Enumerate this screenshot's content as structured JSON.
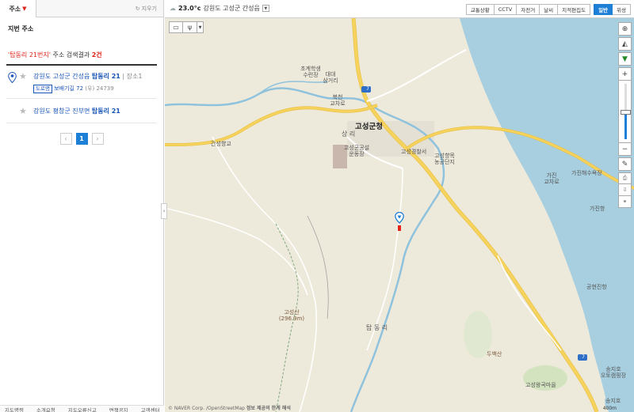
{
  "left_panel": {
    "tab_label": "주소",
    "clear_label": "지우기",
    "section_title": "지번 주소",
    "summary": {
      "query": "'탑동리 21번지'",
      "text": " 주소 검색결과 ",
      "count": "2건"
    },
    "results": [
      {
        "prefix": "강원도 고성군 간성읍 ",
        "highlight": "탑동리 21",
        "sep": " | ",
        "meta": "장소",
        "meta_count": "1",
        "road_badge": "도로명",
        "road_addr": "보배기길 72",
        "zip": " (우) 24739"
      },
      {
        "prefix": "강원도 평창군 진부면 ",
        "highlight": "탑동리 21"
      }
    ],
    "pagination": {
      "prev": "‹",
      "current": "1",
      "next": "›"
    },
    "footer": [
      "지도명령",
      "소개요청",
      "지도오류신고",
      "면책공지",
      "고객센터"
    ]
  },
  "top_bar": {
    "weather_temp": "23.0°c",
    "weather_loc": "강원도 고성군 간성읍",
    "layers": [
      "교통상황",
      "CCTV",
      "자전거",
      "날씨",
      "지적편집도"
    ],
    "map_types": [
      "일반",
      "위성"
    ],
    "active_map_type": "일반"
  },
  "map_labels": {
    "county_office": "고성군청",
    "sangri": "상 리",
    "police": "고성경찰서",
    "stadium": "고성군공설\n운동장",
    "industrial": "고성향목\n농공단지",
    "school": "초계학생\n수련장",
    "daedae": "대대\n삼거리",
    "bukcheon": "북천\n교차로",
    "ganseong_school": "간성향교",
    "gajin_cross": "가진\n교차로",
    "gajin_haesuyok": "가진해수욕장",
    "gajin_port": "가진항",
    "gonghyeon_port": "공현진항",
    "mountain": "고성산\n(296.9m)",
    "tapdongri": "탑 동 리",
    "dubaeksan": "두백산",
    "goseong_wang": "고성왕곡마을",
    "songji": "송지호\n오토캠핑장",
    "songji_lake": "송지호",
    "route_7": "7",
    "scale": "400m",
    "attribution": "© NAVER Corp. /OpenStreetMap",
    "notice": "정보 제공의 한계 해석"
  },
  "colors": {
    "accent": "#1e7fd6",
    "highlight_red": "#e2231a",
    "link_blue": "#1a55b8",
    "sea": "#a8cfe0",
    "land": "#eeeadb",
    "road_major": "#f6d35c",
    "river": "#8fc2dd"
  },
  "icons": {
    "search_result_pin": "map-pin-icon",
    "favorite": "star-icon",
    "bus": "bus-icon",
    "restaurant": "restaurant-icon",
    "current_location": "crosshair-icon",
    "compass": "compass-icon"
  }
}
